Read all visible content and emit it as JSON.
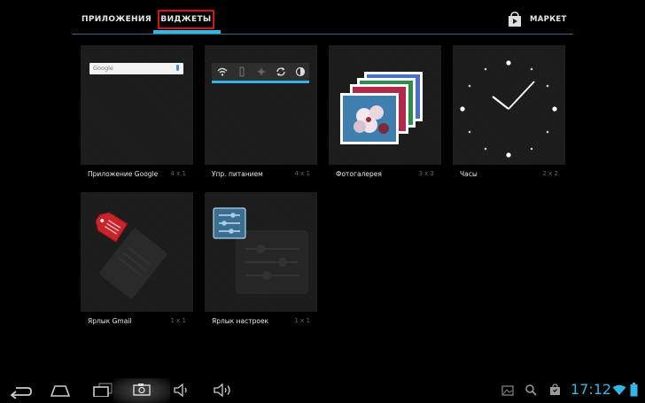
{
  "tabs": {
    "apps_label": "ПРИЛОЖЕНИЯ",
    "widgets_label": "ВИДЖЕТЫ",
    "market_label": "МАРКЕТ"
  },
  "widgets": [
    {
      "name": "Приложение Google",
      "size": "4 x 1"
    },
    {
      "name": "Упр. питанием",
      "size": "4 x 1"
    },
    {
      "name": "Фотогалерея",
      "size": "3 x 3"
    },
    {
      "name": "Часы",
      "size": "2 x 2"
    },
    {
      "name": "Ярлык Gmail",
      "size": "1 x 1"
    },
    {
      "name": "Ярлык настроек",
      "size": "1 x 1"
    }
  ],
  "google_logo_text": "Google",
  "status": {
    "time": "17:12"
  },
  "colors": {
    "accent": "#33b5e5",
    "highlight_box": "#dd1111",
    "background": "#000000"
  },
  "icons": {
    "nav": [
      "back-icon",
      "home-icon",
      "recent-apps-icon",
      "screenshot-icon",
      "volume-down-icon",
      "volume-up-icon"
    ],
    "status": [
      "gallery-notification-icon",
      "search-notification-icon",
      "store-notification-icon",
      "wifi-icon",
      "battery-icon"
    ]
  }
}
